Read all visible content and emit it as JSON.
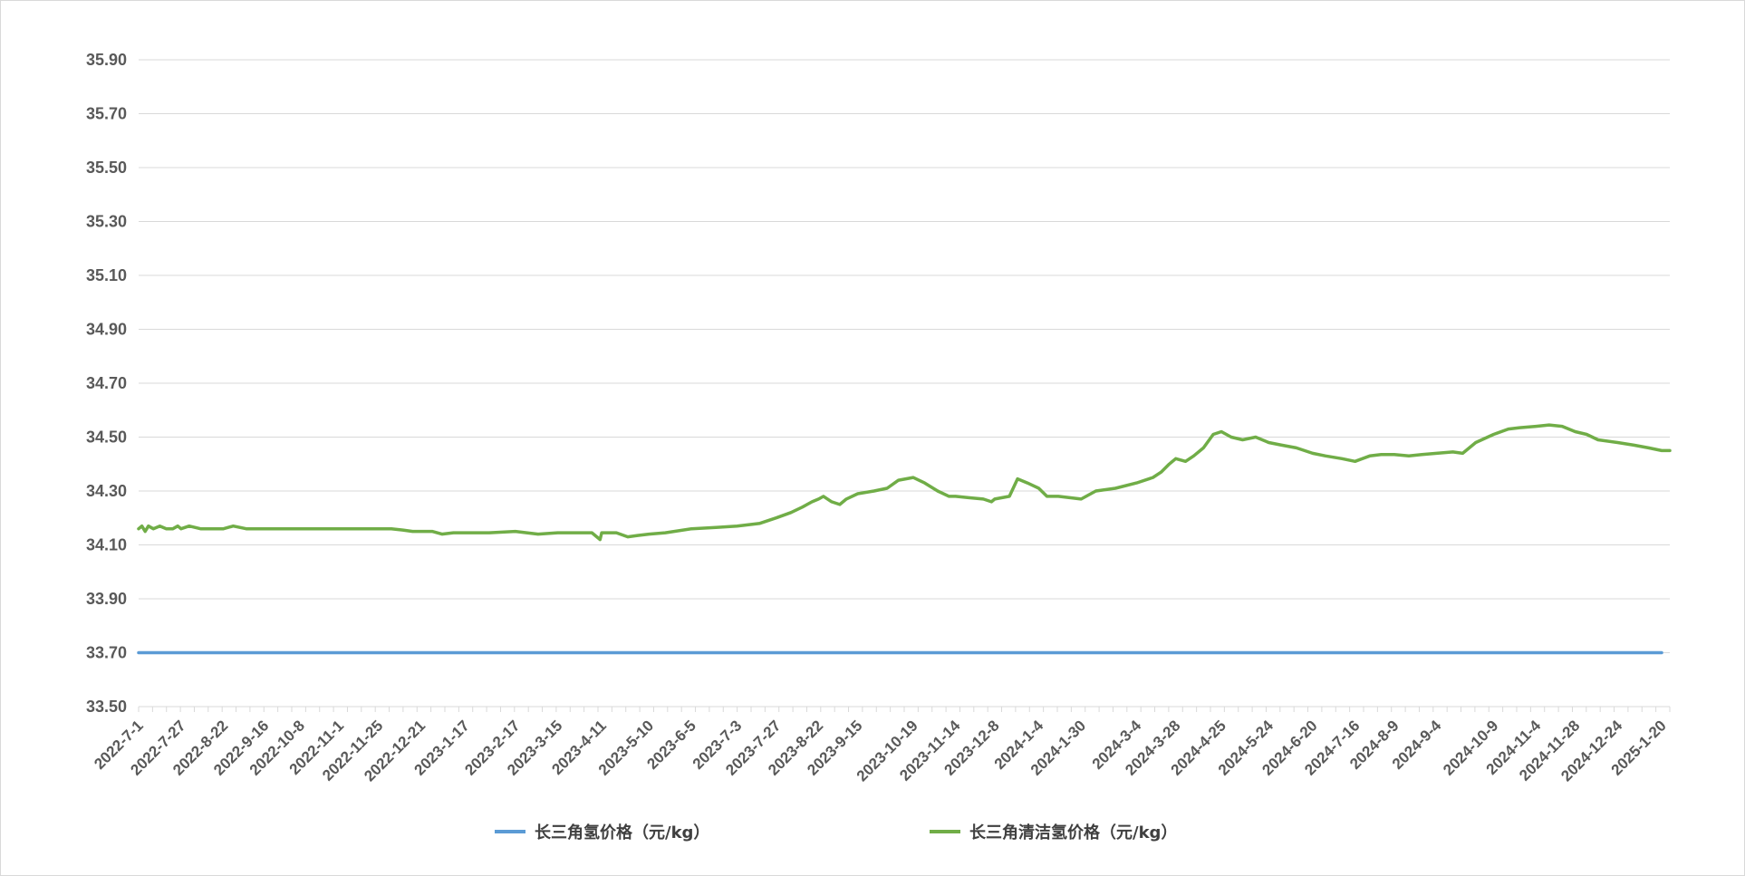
{
  "chart_data": {
    "type": "line",
    "title": "",
    "xlabel": "",
    "ylabel": "",
    "ylim": [
      33.5,
      35.9
    ],
    "yticks": [
      "33.50",
      "33.70",
      "33.90",
      "34.10",
      "34.30",
      "34.50",
      "34.70",
      "34.90",
      "35.10",
      "35.30",
      "35.50",
      "35.70",
      "35.90"
    ],
    "xticks": [
      "2022-7-1",
      "2022-7-27",
      "2022-8-22",
      "2022-9-16",
      "2022-10-8",
      "2022-11-1",
      "2022-11-25",
      "2022-12-21",
      "2023-1-17",
      "2023-2-17",
      "2023-3-15",
      "2023-4-11",
      "2023-5-10",
      "2023-6-5",
      "2023-7-3",
      "2023-7-27",
      "2023-8-22",
      "2023-9-15",
      "2023-10-19",
      "2023-11-14",
      "2023-12-8",
      "2024-1-4",
      "2024-1-30",
      "2024-3-4",
      "2024-3-28",
      "2024-4-25",
      "2024-5-24",
      "2024-6-20",
      "2024-7-16",
      "2024-8-9",
      "2024-9-4",
      "2024-10-9",
      "2024-11-4",
      "2024-11-28",
      "2024-12-24",
      "2025-1-20"
    ],
    "grid": true,
    "legend_position": "bottom",
    "series": [
      {
        "name": "长三角氢价格（元/kg）",
        "color": "#5B9BD5",
        "values": [
          [
            "2022-7-1",
            33.7
          ],
          [
            "2025-1-20",
            33.7
          ]
        ]
      },
      {
        "name": "长三角清洁氢价格（元/kg）",
        "color": "#70AD47",
        "values": [
          [
            "2022-7-1",
            34.16
          ],
          [
            "2022-7-3",
            34.17
          ],
          [
            "2022-7-5",
            34.15
          ],
          [
            "2022-7-7",
            34.17
          ],
          [
            "2022-7-10",
            34.16
          ],
          [
            "2022-7-14",
            34.17
          ],
          [
            "2022-7-18",
            34.16
          ],
          [
            "2022-7-22",
            34.16
          ],
          [
            "2022-7-25",
            34.17
          ],
          [
            "2022-7-27",
            34.16
          ],
          [
            "2022-8-1",
            34.17
          ],
          [
            "2022-8-8",
            34.16
          ],
          [
            "2022-8-15",
            34.16
          ],
          [
            "2022-8-22",
            34.16
          ],
          [
            "2022-8-28",
            34.17
          ],
          [
            "2022-9-5",
            34.16
          ],
          [
            "2022-9-16",
            34.16
          ],
          [
            "2022-9-28",
            34.16
          ],
          [
            "2022-10-8",
            34.16
          ],
          [
            "2022-10-20",
            34.16
          ],
          [
            "2022-11-1",
            34.16
          ],
          [
            "2022-11-13",
            34.16
          ],
          [
            "2022-11-25",
            34.16
          ],
          [
            "2022-12-3",
            34.16
          ],
          [
            "2022-12-10",
            34.155
          ],
          [
            "2022-12-16",
            34.15
          ],
          [
            "2022-12-21",
            34.15
          ],
          [
            "2022-12-28",
            34.15
          ],
          [
            "2023-1-3",
            34.14
          ],
          [
            "2023-1-10",
            34.145
          ],
          [
            "2023-1-17",
            34.145
          ],
          [
            "2023-2-1",
            34.145
          ],
          [
            "2023-2-17",
            34.15
          ],
          [
            "2023-2-24",
            34.145
          ],
          [
            "2023-3-3",
            34.14
          ],
          [
            "2023-3-15",
            34.145
          ],
          [
            "2023-3-25",
            34.145
          ],
          [
            "2023-4-5",
            34.145
          ],
          [
            "2023-4-10",
            34.12
          ],
          [
            "2023-4-11",
            34.145
          ],
          [
            "2023-4-20",
            34.145
          ],
          [
            "2023-4-27",
            34.13
          ],
          [
            "2023-5-3",
            34.135
          ],
          [
            "2023-5-10",
            34.14
          ],
          [
            "2023-5-20",
            34.145
          ],
          [
            "2023-6-5",
            34.16
          ],
          [
            "2023-6-20",
            34.165
          ],
          [
            "2023-7-3",
            34.17
          ],
          [
            "2023-7-10",
            34.175
          ],
          [
            "2023-7-17",
            34.18
          ],
          [
            "2023-7-27",
            34.2
          ],
          [
            "2023-8-5",
            34.22
          ],
          [
            "2023-8-12",
            34.24
          ],
          [
            "2023-8-18",
            34.26
          ],
          [
            "2023-8-22",
            34.27
          ],
          [
            "2023-8-25",
            34.28
          ],
          [
            "2023-8-30",
            34.26
          ],
          [
            "2023-9-4",
            34.25
          ],
          [
            "2023-9-8",
            34.27
          ],
          [
            "2023-9-15",
            34.29
          ],
          [
            "2023-9-25",
            34.3
          ],
          [
            "2023-10-3",
            34.31
          ],
          [
            "2023-10-10",
            34.34
          ],
          [
            "2023-10-19",
            34.35
          ],
          [
            "2023-10-26",
            34.33
          ],
          [
            "2023-11-3",
            34.3
          ],
          [
            "2023-11-10",
            34.28
          ],
          [
            "2023-11-14",
            34.28
          ],
          [
            "2023-11-22",
            34.275
          ],
          [
            "2023-12-1",
            34.27
          ],
          [
            "2023-12-6",
            34.26
          ],
          [
            "2023-12-8",
            34.27
          ],
          [
            "2023-12-17",
            34.28
          ],
          [
            "2023-12-22",
            34.345
          ],
          [
            "2023-12-28",
            34.33
          ],
          [
            "2024-1-4",
            34.31
          ],
          [
            "2024-1-9",
            34.28
          ],
          [
            "2024-1-16",
            34.28
          ],
          [
            "2024-1-23",
            34.275
          ],
          [
            "2024-1-30",
            34.27
          ],
          [
            "2024-2-8",
            34.3
          ],
          [
            "2024-2-20",
            34.31
          ],
          [
            "2024-3-4",
            34.33
          ],
          [
            "2024-3-14",
            34.35
          ],
          [
            "2024-3-19",
            34.37
          ],
          [
            "2024-3-24",
            34.4
          ],
          [
            "2024-3-28",
            34.42
          ],
          [
            "2024-4-3",
            34.41
          ],
          [
            "2024-4-8",
            34.43
          ],
          [
            "2024-4-14",
            34.46
          ],
          [
            "2024-4-20",
            34.51
          ],
          [
            "2024-4-25",
            34.52
          ],
          [
            "2024-5-1",
            34.5
          ],
          [
            "2024-5-8",
            34.49
          ],
          [
            "2024-5-16",
            34.5
          ],
          [
            "2024-5-24",
            34.48
          ],
          [
            "2024-6-1",
            34.47
          ],
          [
            "2024-6-10",
            34.46
          ],
          [
            "2024-6-20",
            34.44
          ],
          [
            "2024-6-28",
            34.43
          ],
          [
            "2024-7-8",
            34.42
          ],
          [
            "2024-7-16",
            34.41
          ],
          [
            "2024-7-25",
            34.43
          ],
          [
            "2024-8-1",
            34.435
          ],
          [
            "2024-8-9",
            34.435
          ],
          [
            "2024-8-18",
            34.43
          ],
          [
            "2024-8-26",
            34.435
          ],
          [
            "2024-9-4",
            34.44
          ],
          [
            "2024-9-14",
            34.445
          ],
          [
            "2024-9-20",
            34.44
          ],
          [
            "2024-9-28",
            34.48
          ],
          [
            "2024-10-9",
            34.51
          ],
          [
            "2024-10-18",
            34.53
          ],
          [
            "2024-10-25",
            34.535
          ],
          [
            "2024-11-4",
            34.54
          ],
          [
            "2024-11-12",
            34.545
          ],
          [
            "2024-11-20",
            34.54
          ],
          [
            "2024-11-28",
            34.52
          ],
          [
            "2024-12-5",
            34.51
          ],
          [
            "2024-12-12",
            34.49
          ],
          [
            "2024-12-24",
            34.48
          ],
          [
            "2025-1-3",
            34.47
          ],
          [
            "2025-1-12",
            34.46
          ],
          [
            "2025-1-20",
            34.45
          ],
          [
            "2025-1-25",
            34.45
          ]
        ]
      }
    ]
  }
}
